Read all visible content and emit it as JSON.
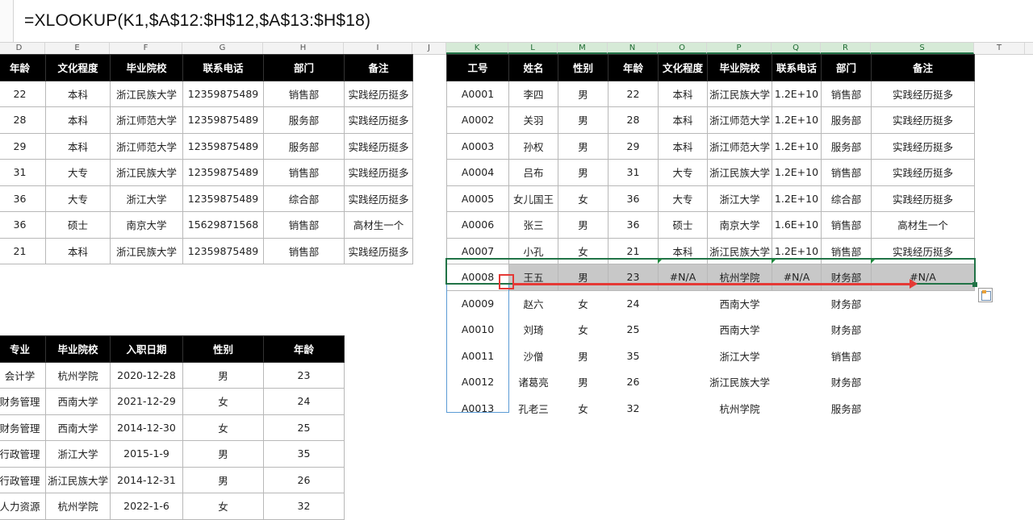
{
  "formula_bar": {
    "formula": "=XLOOKUP(K1,$A$12:$H$12,$A$13:$H$18)"
  },
  "column_headers": [
    "D",
    "E",
    "F",
    "G",
    "H",
    "I",
    "J",
    "K",
    "L",
    "M",
    "N",
    "O",
    "P",
    "Q",
    "R",
    "S",
    "T"
  ],
  "left_top_table": {
    "header": [
      "年龄",
      "文化程度",
      "毕业院校",
      "联系电话",
      "部门",
      "备注"
    ],
    "rows": [
      [
        "22",
        "本科",
        "浙江民族大学",
        "12359875489",
        "销售部",
        "实践经历挺多"
      ],
      [
        "28",
        "本科",
        "浙江师范大学",
        "12359875489",
        "服务部",
        "实践经历挺多"
      ],
      [
        "29",
        "本科",
        "浙江师范大学",
        "12359875489",
        "服务部",
        "实践经历挺多"
      ],
      [
        "31",
        "大专",
        "浙江民族大学",
        "12359875489",
        "销售部",
        "实践经历挺多"
      ],
      [
        "36",
        "大专",
        "浙江大学",
        "12359875489",
        "综合部",
        "实践经历挺多"
      ],
      [
        "36",
        "硕士",
        "南京大学",
        "15629871568",
        "销售部",
        "高材生一个"
      ],
      [
        "21",
        "本科",
        "浙江民族大学",
        "12359875489",
        "销售部",
        "实践经历挺多"
      ]
    ]
  },
  "left_bottom_table": {
    "header": [
      "专业",
      "毕业院校",
      "入职日期",
      "性别",
      "年龄"
    ],
    "rows": [
      [
        "会计学",
        "杭州学院",
        "2020-12-28",
        "男",
        "23"
      ],
      [
        "财务管理",
        "西南大学",
        "2021-12-29",
        "女",
        "24"
      ],
      [
        "财务管理",
        "西南大学",
        "2014-12-30",
        "女",
        "25"
      ],
      [
        "行政管理",
        "浙江大学",
        "2015-1-9",
        "男",
        "35"
      ],
      [
        "行政管理",
        "浙江民族大学",
        "2014-12-31",
        "男",
        "26"
      ],
      [
        "人力资源",
        "杭州学院",
        "2022-1-6",
        "女",
        "32"
      ]
    ]
  },
  "right_table": {
    "header": [
      "工号",
      "姓名",
      "性别",
      "年龄",
      "文化程度",
      "毕业院校",
      "联系电话",
      "部门",
      "备注"
    ],
    "rows": [
      [
        "A0001",
        "李四",
        "男",
        "22",
        "本科",
        "浙江民族大学",
        "1.2E+10",
        "销售部",
        "实践经历挺多"
      ],
      [
        "A0002",
        "关羽",
        "男",
        "28",
        "本科",
        "浙江师范大学",
        "1.2E+10",
        "服务部",
        "实践经历挺多"
      ],
      [
        "A0003",
        "孙权",
        "男",
        "29",
        "本科",
        "浙江师范大学",
        "1.2E+10",
        "服务部",
        "实践经历挺多"
      ],
      [
        "A0004",
        "吕布",
        "男",
        "31",
        "大专",
        "浙江民族大学",
        "1.2E+10",
        "销售部",
        "实践经历挺多"
      ],
      [
        "A0005",
        "女儿国王",
        "女",
        "36",
        "大专",
        "浙江大学",
        "1.2E+10",
        "综合部",
        "实践经历挺多"
      ],
      [
        "A0006",
        "张三",
        "男",
        "36",
        "硕士",
        "南京大学",
        "1.6E+10",
        "销售部",
        "高材生一个"
      ],
      [
        "A0007",
        "小孔",
        "女",
        "21",
        "本科",
        "浙江民族大学",
        "1.2E+10",
        "销售部",
        "实践经历挺多"
      ],
      [
        "A0008",
        "王五",
        "男",
        "23",
        "#N/A",
        "杭州学院",
        "#N/A",
        "财务部",
        "#N/A"
      ],
      [
        "A0009",
        "赵六",
        "女",
        "24",
        "",
        "西南大学",
        "",
        "财务部",
        ""
      ],
      [
        "A0010",
        "刘琦",
        "女",
        "25",
        "",
        "西南大学",
        "",
        "财务部",
        ""
      ],
      [
        "A0011",
        "沙僧",
        "男",
        "35",
        "",
        "浙江大学",
        "",
        "销售部",
        ""
      ],
      [
        "A0012",
        "诸葛亮",
        "男",
        "26",
        "",
        "浙江民族大学",
        "",
        "财务部",
        ""
      ],
      [
        "A0013",
        "孔老三",
        "女",
        "32",
        "",
        "杭州学院",
        "",
        "服务部",
        ""
      ]
    ]
  }
}
